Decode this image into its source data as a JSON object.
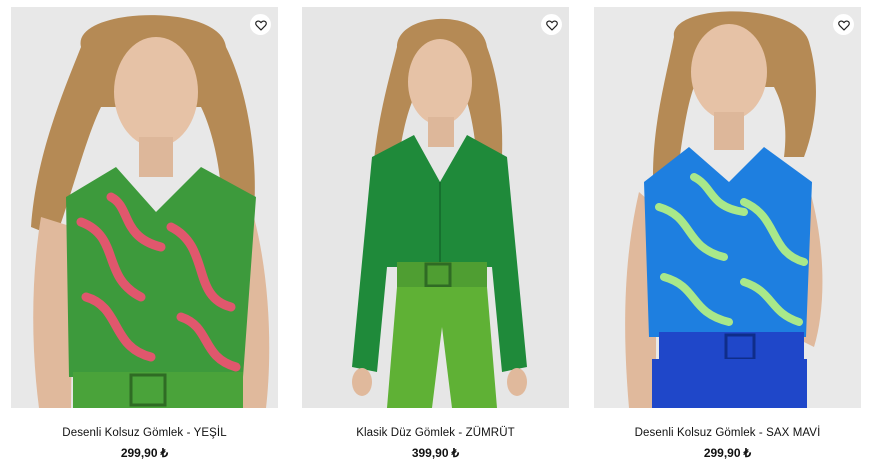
{
  "products": [
    {
      "name": "Desenli Kolsuz Gömlek - YEŞİL",
      "price": "299,90",
      "currency": "₺",
      "colors": {
        "main": "#3d9a3c",
        "accent": "#e0576d",
        "bottom": "#4aa33a",
        "background": "#e8e8e8"
      }
    },
    {
      "name": "Klasik Düz Gömlek - ZÜMRÜT",
      "price": "399,90",
      "currency": "₺",
      "colors": {
        "main": "#1f8a3a",
        "accent": "#1f8a3a",
        "bottom": "#5fb135",
        "background": "#e6e6e6"
      }
    },
    {
      "name": "Desenli Kolsuz Gömlek - SAX MAVİ",
      "price": "299,90",
      "currency": "₺",
      "colors": {
        "main": "#1e7fe0",
        "accent": "#a9e88a",
        "bottom": "#1f47c9",
        "background": "#e9e9e9"
      }
    }
  ],
  "icons": {
    "favorite": "heart-outline-icon"
  }
}
